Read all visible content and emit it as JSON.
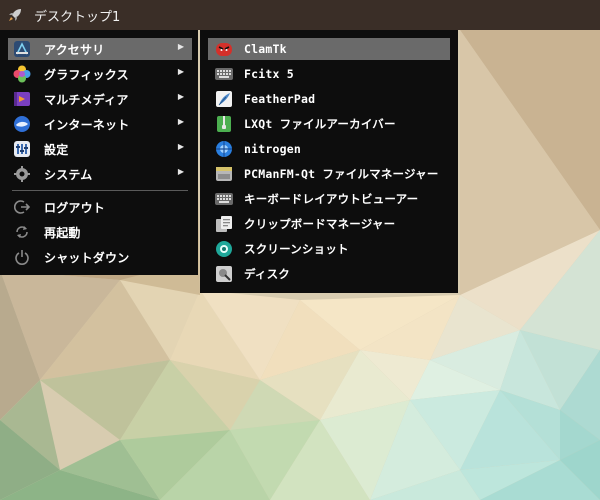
{
  "taskbar": {
    "title": "デスクトップ1",
    "launcher_icon": "rocket-icon"
  },
  "main_menu": {
    "items": [
      {
        "label": "アクセサリ",
        "icon": "accessories-icon",
        "has_submenu": true,
        "active": true
      },
      {
        "label": "グラフィックス",
        "icon": "graphics-icon",
        "has_submenu": true
      },
      {
        "label": "マルチメディア",
        "icon": "multimedia-icon",
        "has_submenu": true
      },
      {
        "label": "インターネット",
        "icon": "internet-icon",
        "has_submenu": true
      },
      {
        "label": "設定",
        "icon": "settings-icon",
        "has_submenu": true
      },
      {
        "label": "システム",
        "icon": "system-icon",
        "has_submenu": true
      }
    ],
    "session_items": [
      {
        "label": "ログアウト",
        "icon": "logout-icon"
      },
      {
        "label": "再起動",
        "icon": "reboot-icon"
      },
      {
        "label": "シャットダウン",
        "icon": "shutdown-icon"
      }
    ]
  },
  "submenu": {
    "items": [
      {
        "label": "ClamTk",
        "icon": "clamtk-icon",
        "active": true
      },
      {
        "label": "Fcitx 5",
        "icon": "keyboard-icon"
      },
      {
        "label": "FeatherPad",
        "icon": "featherpad-icon"
      },
      {
        "label": "LXQt ファイルアーカイバー",
        "icon": "archiver-icon"
      },
      {
        "label": "nitrogen",
        "icon": "nitrogen-icon"
      },
      {
        "label": "PCManFM-Qt ファイルマネージャー",
        "icon": "file-manager-icon"
      },
      {
        "label": "キーボードレイアウトビューアー",
        "icon": "keyboard-icon"
      },
      {
        "label": "クリップボードマネージャー",
        "icon": "clipboard-icon"
      },
      {
        "label": "スクリーンショット",
        "icon": "screenshot-icon"
      },
      {
        "label": "ディスク",
        "icon": "disk-icon"
      }
    ]
  },
  "colors": {
    "taskbar_bg": "#3a2e27",
    "menu_bg": "#0d0d0d",
    "highlight": "#6a6a6a"
  }
}
